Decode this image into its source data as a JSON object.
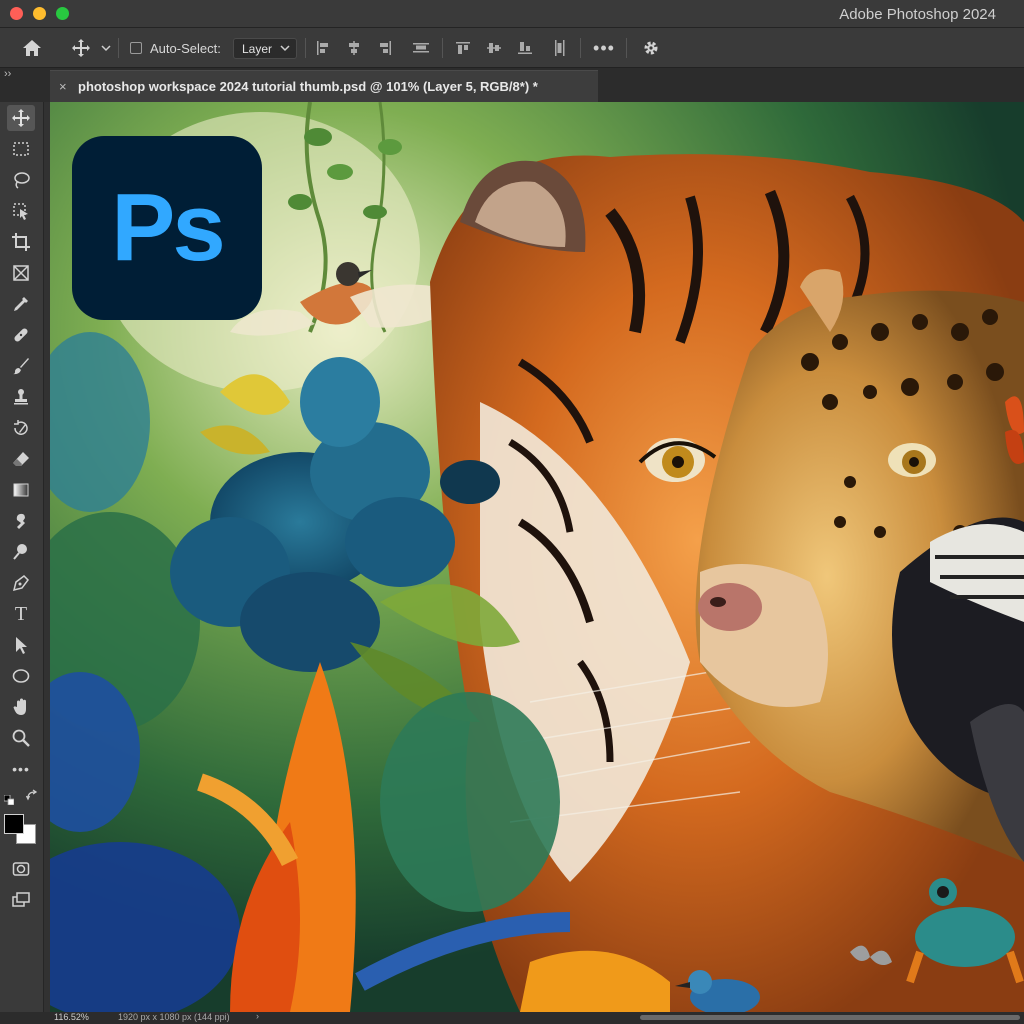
{
  "window": {
    "app_title": "Adobe Photoshop 2024"
  },
  "options_bar": {
    "auto_select_label": "Auto-Select:",
    "auto_select_checked": false,
    "auto_select_target": "Layer",
    "more_label": "•••"
  },
  "tab_bar": {
    "collapse_label": "››",
    "document_tab": {
      "close_label": "×",
      "label": "photoshop workspace 2024 tutorial thumb.psd @ 101% (Layer 5, RGB/8*) *"
    }
  },
  "toolbar": {
    "active_tool": "move-tool",
    "tools": [
      "move-tool",
      "rectangular-marquee-tool",
      "lasso-tool",
      "object-selection-tool",
      "crop-tool",
      "frame-tool",
      "eyedropper-tool",
      "spot-healing-brush-tool",
      "brush-tool",
      "clone-stamp-tool",
      "history-brush-tool",
      "eraser-tool",
      "gradient-tool",
      "smudge-tool",
      "dodge-tool",
      "pen-tool",
      "type-tool",
      "path-selection-tool",
      "ellipse-tool",
      "hand-tool",
      "zoom-tool",
      "more-tools"
    ],
    "type_tool_label": "T",
    "more_tools_label": "•••",
    "foreground_color": "#000000",
    "background_color": "#ffffff"
  },
  "canvas": {
    "logo_text": "Ps",
    "logo_bg": "#001e36",
    "logo_fg": "#31a8ff"
  },
  "status_bar": {
    "zoom": "116.52%",
    "document_size": "1920 px x 1080 px (144 ppi)",
    "arrow_label": "›"
  }
}
